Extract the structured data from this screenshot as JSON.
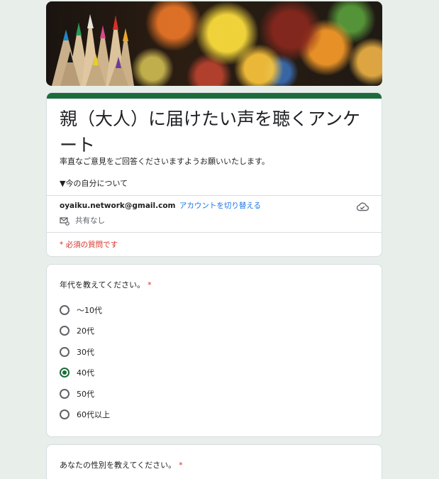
{
  "form": {
    "title": "親（大人）に届けたい声を聴くアンケート",
    "description": "率直なご意見をご回答くださいますようお願いいたします。",
    "section_intro": "▼今の自分について",
    "account_email": "oyaiku.network@gmail.com",
    "switch_account_label": "アカウントを切り替える",
    "share_status": "共有なし",
    "required_note": "* 必須の質問です"
  },
  "questions": [
    {
      "text": "年代を教えてください。",
      "required_mark": "*",
      "options": [
        "〜10代",
        "20代",
        "30代",
        "40代",
        "50代",
        "60代以上"
      ],
      "selected": "40代"
    },
    {
      "text": "あなたの性別を教えてください。",
      "required_mark": "*"
    }
  ],
  "colors": {
    "theme": "#1c6b3c",
    "background": "#e8efea",
    "required": "#d93025",
    "link": "#1a73e8"
  },
  "icons": {
    "share": "mail-settings-icon",
    "cloud": "cloud-check-icon"
  }
}
